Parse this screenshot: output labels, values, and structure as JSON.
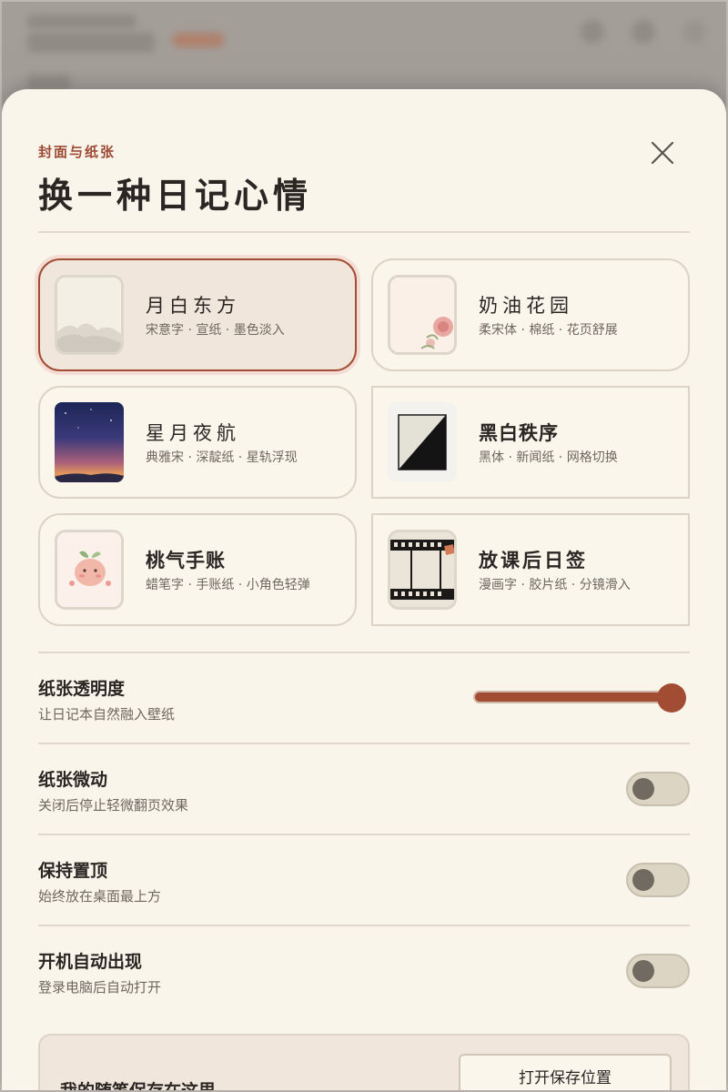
{
  "sheet": {
    "eyebrow": "封面与纸张",
    "title": "换一种日记心情"
  },
  "themes": [
    {
      "name": "月白东方",
      "desc": "宋意字 · 宣纸 · 墨色淡入",
      "selected": true,
      "thumb": "ink-mountain-icon"
    },
    {
      "name": "奶油花园",
      "desc": "柔宋体 · 棉纸 · 花页舒展",
      "selected": false,
      "thumb": "flower-icon"
    },
    {
      "name": "星月夜航",
      "desc": "典雅宋 · 深靛纸 · 星轨浮现",
      "selected": false,
      "thumb": "night-sky-icon"
    },
    {
      "name": "黑白秩序",
      "desc": "黑体 · 新闻纸 · 网格切换",
      "selected": false,
      "thumb": "black-white-icon"
    },
    {
      "name": "桃气手账",
      "desc": "蜡笔字 · 手账纸 · 小角色轻弹",
      "selected": false,
      "thumb": "peach-character-icon"
    },
    {
      "name": "放课后日签",
      "desc": "漫画字 · 胶片纸 · 分镜滑入",
      "selected": false,
      "thumb": "film-strip-icon"
    }
  ],
  "settings": {
    "opacity": {
      "title": "纸张透明度",
      "sub": "让日记本自然融入壁纸",
      "value": 1.0
    },
    "motion": {
      "title": "纸张微动",
      "sub": "关闭后停止轻微翻页效果",
      "on": false
    },
    "pin": {
      "title": "保持置顶",
      "sub": "始终放在桌面最上方",
      "on": false
    },
    "autostart": {
      "title": "开机自动出现",
      "sub": "登录电脑后自动打开",
      "on": false
    }
  },
  "save": {
    "label": "我的随笔保存在这里",
    "button": "打开保存位置"
  },
  "colors": {
    "accent": "#a24c34",
    "paper": "#faf5ea",
    "selected_bg": "#f1e6db"
  }
}
